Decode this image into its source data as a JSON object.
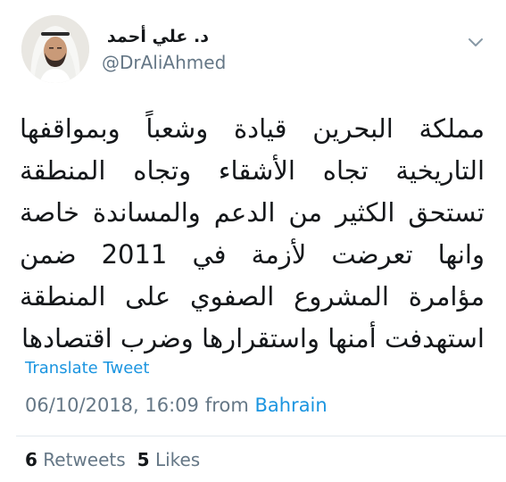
{
  "tweet": {
    "author": {
      "display_name": "د. علي أحمد",
      "handle": "@DrAliAhmed",
      "avatar_icon": "profile-photo"
    },
    "menu_icon": "chevron-down-icon",
    "text": "مملكة البحرين قيادة وشعباً وبمواقفها التاريخية تجاه الأشقاء وتجاه المنطقة تستحق الكثير من الدعم والمساندة خاصة وانها تعرضت لأزمة في 2011 ضمن مؤامرة المشروع الصفوي على المنطقة استهدفت أمنها واستقرارها وضرب اقتصادها",
    "translate_label": "Translate Tweet",
    "timestamp": "06/10/2018, 16:09",
    "from_label": "from",
    "location": "Bahrain",
    "stats": {
      "retweets_count": "6",
      "retweets_label": "Retweets",
      "likes_count": "5",
      "likes_label": "Likes"
    },
    "colors": {
      "text": "#14171a",
      "secondary": "#657786",
      "link": "#1b95e0",
      "divider": "#e1e8ed"
    }
  }
}
